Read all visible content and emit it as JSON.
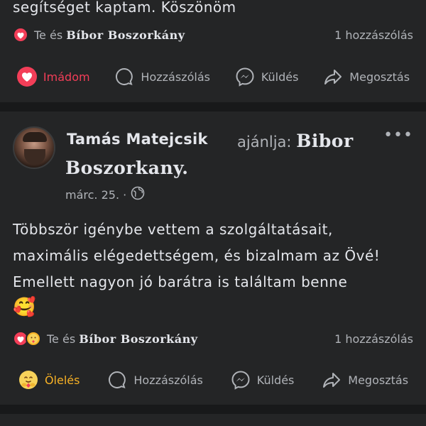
{
  "post1": {
    "text_tail": "segítséget kaptam. Köszönöm",
    "reactions_text_prefix": "Te és",
    "reactions_text_name": "Bíbor Boszorkány",
    "comment_count": "1 hozzászólás",
    "actions": {
      "love": "Imádom",
      "comment": "Hozzászólás",
      "send": "Küldés",
      "share": "Megosztás"
    }
  },
  "post2": {
    "author": "Tamás Matejcsik",
    "recommends": "ajánlja:",
    "page_name_part1": "Bibor",
    "page_name_part2": "Boszorkany.",
    "date": "márc. 25. ·",
    "more": "•••",
    "text_lines": [
      "Többször igénybe vettem a szolgáltatásait,",
      "maximális elégedettségem, és bizalmam az Övé!",
      "Emellett nagyon jó barátra is találtam benne",
      "🥰"
    ],
    "reactions_text_prefix": "Te és",
    "reactions_text_name": "Bíbor Boszorkány",
    "comment_count": "1 hozzászólás",
    "actions": {
      "care": "Ölelés",
      "comment": "Hozzászólás",
      "send": "Küldés",
      "share": "Megosztás"
    }
  },
  "colors": {
    "background": "#18191a",
    "card": "#242526",
    "text": "#e4e6eb",
    "secondary": "#b0b3b8",
    "love": "#f33e58",
    "care": "#f7b125"
  },
  "icons": [
    "heart-icon",
    "care-emoji-icon",
    "comment-bubble-icon",
    "messenger-icon",
    "share-arrow-icon",
    "globe-icon",
    "more-dots-icon"
  ]
}
